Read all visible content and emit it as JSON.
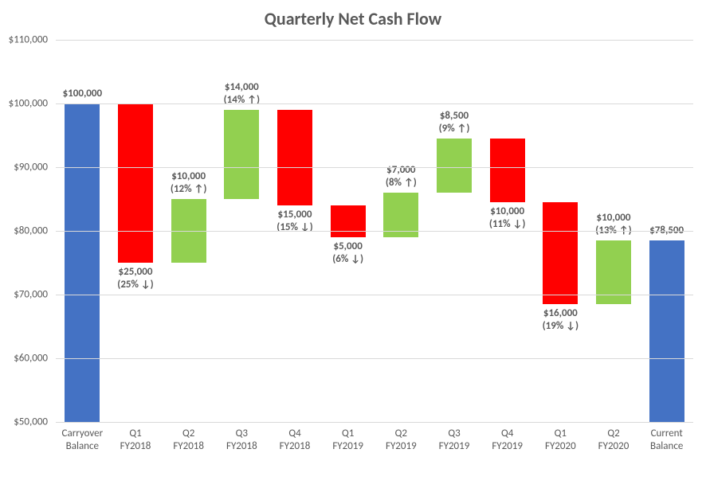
{
  "chart_data": {
    "type": "bar",
    "title": "Quarterly Net Cash Flow",
    "ylabel": "",
    "xlabel": "",
    "ylim": [
      50000,
      110000
    ],
    "y_ticks": [
      50000,
      60000,
      70000,
      80000,
      90000,
      100000,
      110000
    ],
    "y_tick_labels": [
      "$50,000",
      "$60,000",
      "$70,000",
      "$80,000",
      "$90,000",
      "$100,000",
      "$110,000"
    ],
    "categories": [
      "Carryover\nBalance",
      "Q1\nFY2018",
      "Q2\nFY2018",
      "Q3\nFY2018",
      "Q4\nFY2018",
      "Q1\nFY2019",
      "Q2\nFY2019",
      "Q3\nFY2019",
      "Q4\nFY2019",
      "Q1\nFY2020",
      "Q2\nFY2020",
      "Current\nBalance"
    ],
    "bars": [
      {
        "kind": "total",
        "start": 50000,
        "end": 100000,
        "color": "blue",
        "label": "$100,000",
        "label_pos": "above"
      },
      {
        "kind": "decrease",
        "start": 100000,
        "end": 75000,
        "delta": -25000,
        "pct": "25%",
        "color": "red",
        "label": "$25,000\n(25% ↓)",
        "label_pos": "below"
      },
      {
        "kind": "increase",
        "start": 75000,
        "end": 85000,
        "delta": 10000,
        "pct": "12%",
        "color": "green",
        "label": "$10,000\n(12% ↑)",
        "label_pos": "above"
      },
      {
        "kind": "increase",
        "start": 85000,
        "end": 99000,
        "delta": 14000,
        "pct": "14%",
        "color": "green",
        "label": "$14,000\n(14% ↑)",
        "label_pos": "above"
      },
      {
        "kind": "decrease",
        "start": 99000,
        "end": 84000,
        "delta": -15000,
        "pct": "15%",
        "color": "red",
        "label": "$15,000\n(15% ↓)",
        "label_pos": "below"
      },
      {
        "kind": "decrease",
        "start": 84000,
        "end": 79000,
        "delta": -5000,
        "pct": "6%",
        "color": "red",
        "label": "$5,000\n(6% ↓)",
        "label_pos": "below"
      },
      {
        "kind": "increase",
        "start": 79000,
        "end": 86000,
        "delta": 7000,
        "pct": "8%",
        "color": "green",
        "label": "$7,000\n(8% ↑)",
        "label_pos": "above"
      },
      {
        "kind": "increase",
        "start": 86000,
        "end": 94500,
        "delta": 8500,
        "pct": "9%",
        "color": "green",
        "label": "$8,500\n(9% ↑)",
        "label_pos": "above"
      },
      {
        "kind": "decrease",
        "start": 94500,
        "end": 84500,
        "delta": -10000,
        "pct": "11%",
        "color": "red",
        "label": "$10,000\n(11% ↓)",
        "label_pos": "below"
      },
      {
        "kind": "decrease",
        "start": 84500,
        "end": 68500,
        "delta": -16000,
        "pct": "19%",
        "color": "red",
        "label": "$16,000\n(19% ↓)",
        "label_pos": "below"
      },
      {
        "kind": "increase",
        "start": 68500,
        "end": 78500,
        "delta": 10000,
        "pct": "13%",
        "color": "green",
        "label": "$10,000\n(13% ↑)",
        "label_pos": "above"
      },
      {
        "kind": "total",
        "start": 50000,
        "end": 78500,
        "color": "blue",
        "label": "$78,500",
        "label_pos": "above"
      }
    ],
    "colors": {
      "total": "#4472c4",
      "increase": "#92d050",
      "decrease": "#ff0000"
    }
  }
}
